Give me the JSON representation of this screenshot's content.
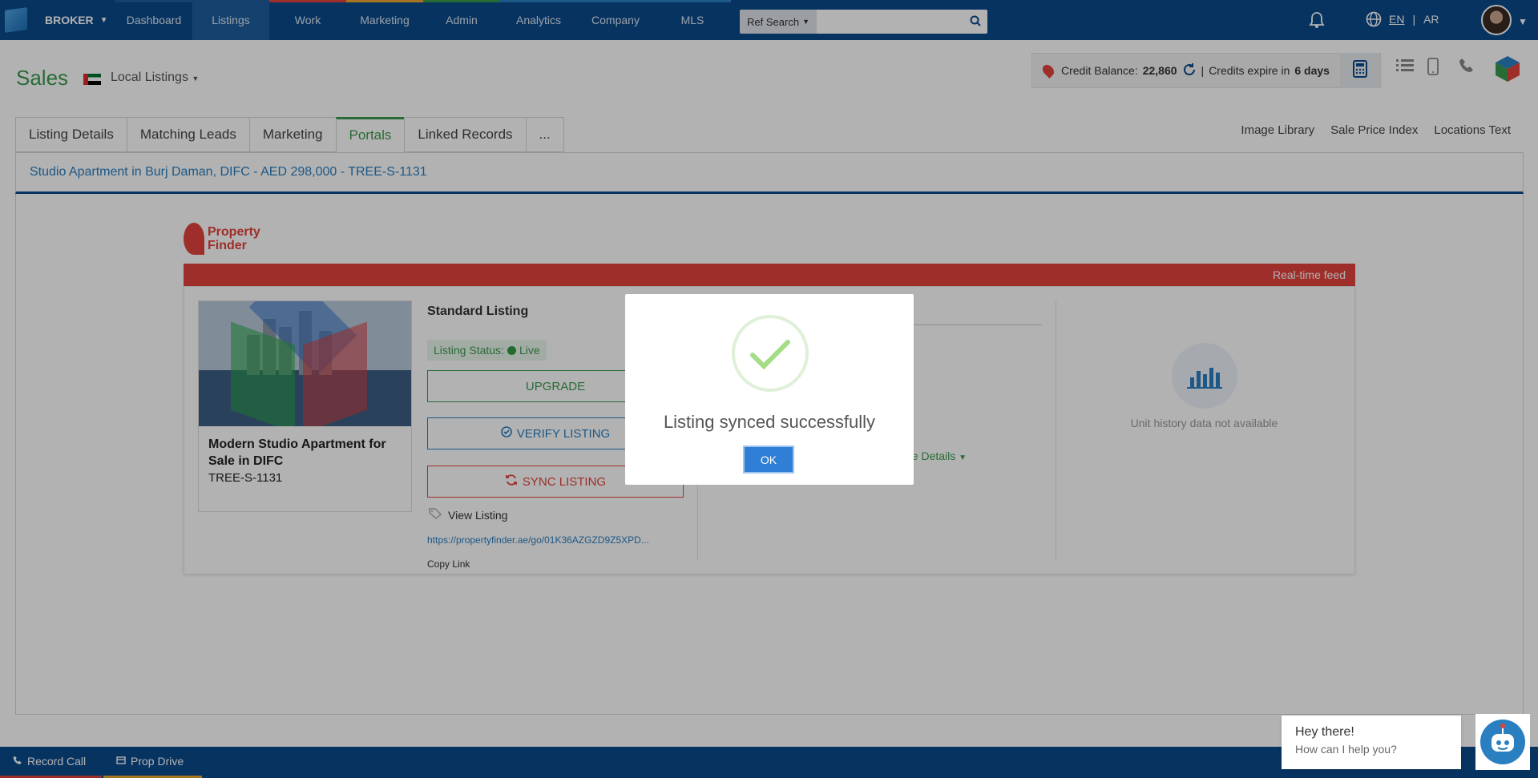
{
  "nav": {
    "brand": "BROKER",
    "items": [
      {
        "label": "Dashboard",
        "color": "#1d5d9c"
      },
      {
        "label": "Listings",
        "color": "#1d5d9c"
      },
      {
        "label": "Work",
        "color": "#e3433d"
      },
      {
        "label": "Marketing",
        "color": "#f0a830"
      },
      {
        "label": "Admin",
        "color": "#3c9a4f"
      },
      {
        "label": "Analytics",
        "color": "#2a7fc0"
      },
      {
        "label": "Company",
        "color": "#2a7fc0"
      },
      {
        "label": "MLS",
        "color": "#2a7fc0"
      }
    ],
    "active": "Listings",
    "ref_search": "Ref Search",
    "search_value": "",
    "lang_en": "EN",
    "lang_ar": "AR"
  },
  "header": {
    "title": "Sales",
    "dropdown": "Local Listings",
    "credit_label": "Credit Balance:",
    "credit_value": "22,860",
    "expire_label": "Credits expire in",
    "expire_value": "6 days"
  },
  "tabs": [
    "Listing Details",
    "Matching Leads",
    "Marketing",
    "Portals",
    "Linked Records",
    "..."
  ],
  "active_tab": "Portals",
  "right_links": [
    "Image Library",
    "Sale Price Index",
    "Locations Text"
  ],
  "listing_title": "Studio Apartment in Burj Daman, DIFC - AED 298,000 - TREE-S-1131",
  "portal": {
    "logo_line1": "Property",
    "logo_line2": "Finder",
    "feed_label": "Real-time feed",
    "card_title": "Modern Studio Apartment for Sale in DIFC",
    "card_ref": "TREE-S-1131",
    "listing_type": "Standard Listing",
    "status_label": "Listing Status:",
    "status_value": "Live",
    "upgrade": "UPGRADE",
    "verify": "VERIFY LISTING",
    "sync": "SYNC LISTING",
    "view_listing": "View Listing",
    "link": "https://propertyfinder.ae/go/01K36AZGZD9Z5XPD...",
    "copy_link": "Copy Link",
    "fee_details": "ee Details",
    "unit_history": "Unit history data not available"
  },
  "modal": {
    "message": "Listing synced successfully",
    "ok": "OK"
  },
  "footer": {
    "record_call": "Record Call",
    "prop_drive": "Prop Drive"
  },
  "chat": {
    "greeting": "Hey there!",
    "prompt": "How can I help you?"
  }
}
